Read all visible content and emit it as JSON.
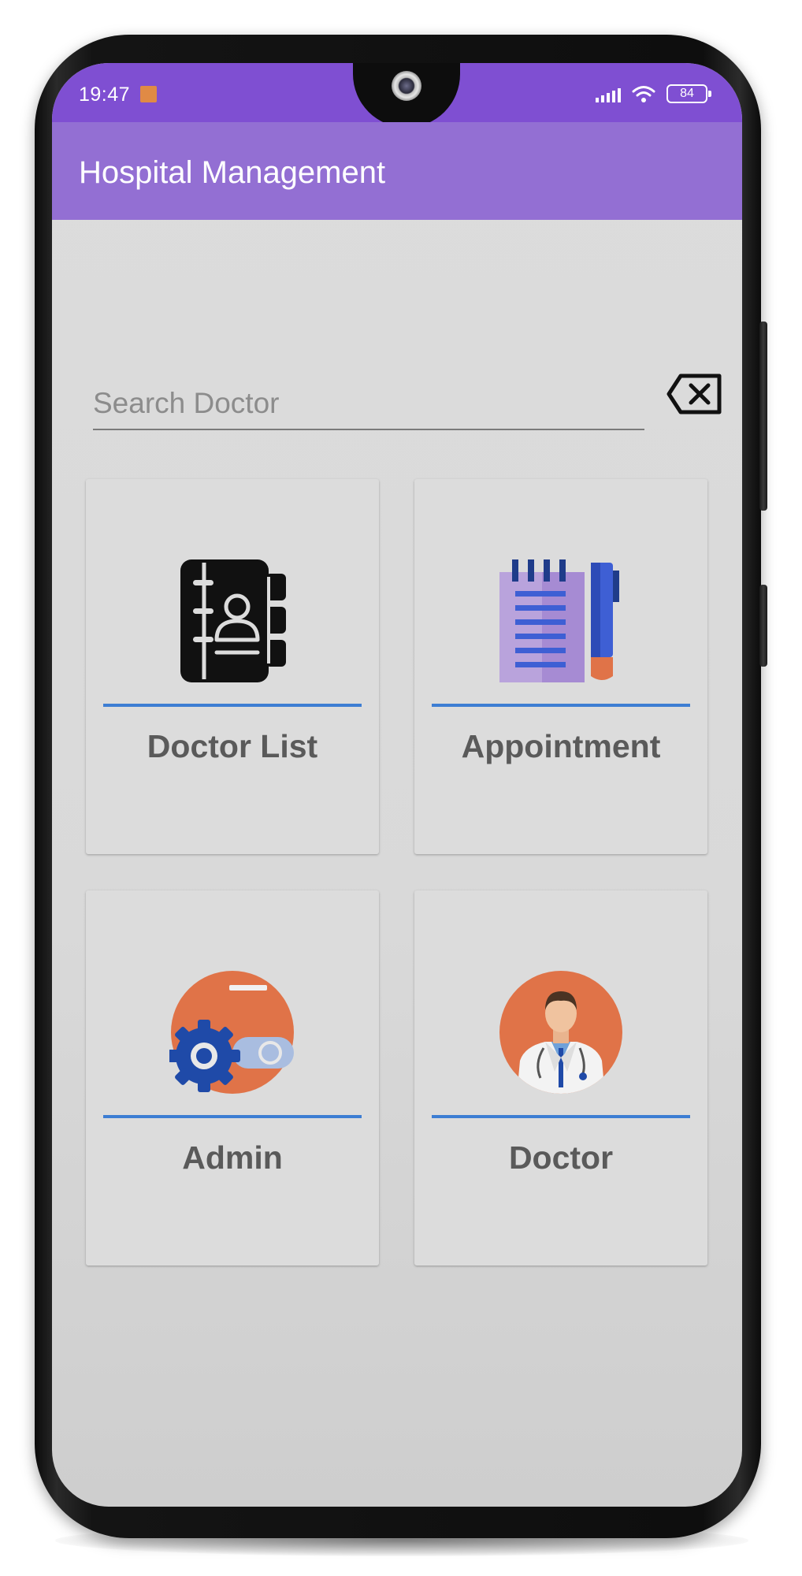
{
  "status_bar": {
    "time": "19:47",
    "battery": "84"
  },
  "app_bar": {
    "title": "Hospital Management"
  },
  "search": {
    "placeholder": "Search Doctor",
    "value": ""
  },
  "cards": [
    {
      "label": "Doctor List",
      "icon": "contact-book-icon"
    },
    {
      "label": "Appointment",
      "icon": "notepad-pen-icon"
    },
    {
      "label": "Admin",
      "icon": "admin-gear-icon"
    },
    {
      "label": "Doctor",
      "icon": "doctor-avatar-icon"
    }
  ],
  "colors": {
    "status_bar": "#7f4fd2",
    "app_bar": "#936fd3",
    "divider": "#3d7ed3",
    "card_label": "#5a5a5a",
    "icon_orange": "#e07348"
  }
}
